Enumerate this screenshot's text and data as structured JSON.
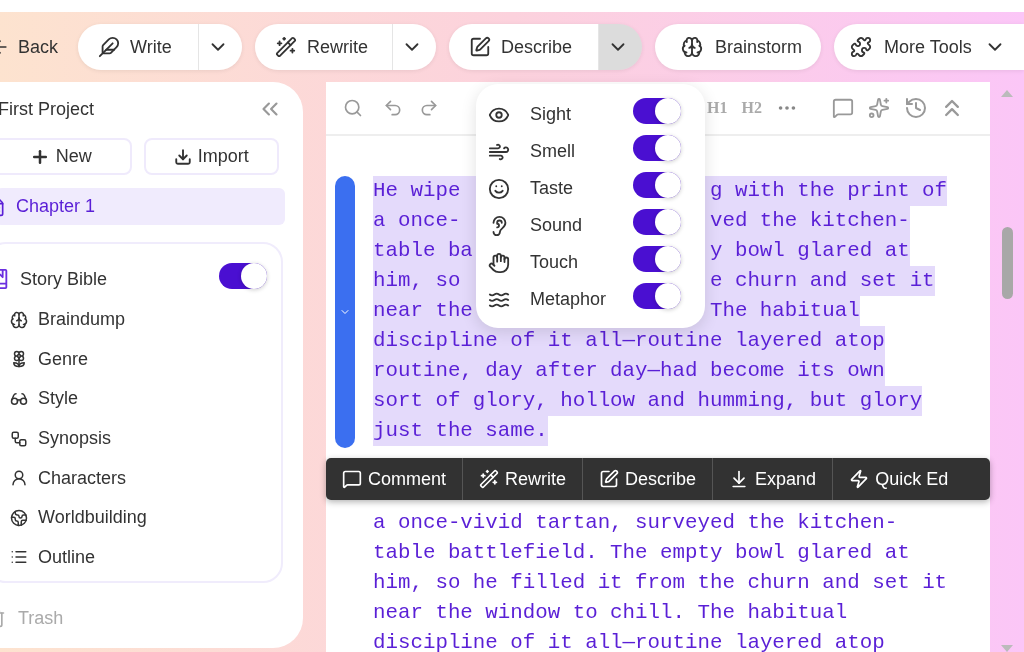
{
  "top_bar": {
    "back": "Back",
    "tools": [
      {
        "label": "Write",
        "kind": "split",
        "open": false
      },
      {
        "label": "Rewrite",
        "kind": "split",
        "open": false
      },
      {
        "label": "Describe",
        "kind": "split",
        "open": true
      },
      {
        "label": "Brainstorm",
        "kind": "plain"
      },
      {
        "label": "More Tools",
        "kind": "menu"
      }
    ]
  },
  "sidebar": {
    "project": "First Project",
    "new": "New",
    "import": "Import",
    "chapters": [
      {
        "label": "Chapter 1",
        "selected": true
      }
    ],
    "story_bible": {
      "label": "Story Bible",
      "on": true,
      "items": [
        "Braindump",
        "Genre",
        "Style",
        "Synopsis",
        "Characters",
        "Worldbuilding",
        "Outline"
      ]
    },
    "trash": "Trash"
  },
  "editor": {
    "toolbar": {
      "headings": [
        "H1",
        "H2"
      ]
    },
    "selected_paragraph": [
      {
        "left": "He wipe",
        "right": "g with the print of"
      },
      {
        "left": "a once-",
        "right": "ved the kitchen-"
      },
      {
        "left": "table ba",
        "right": "y bowl glared at"
      },
      {
        "left": "him, so",
        "right": "e churn and set it"
      },
      {
        "left": "near the",
        "right": "The habitual"
      },
      {
        "left": "discipline of it all—routine layered atop"
      },
      {
        "left": "routine, day after day—had become its own"
      },
      {
        "left": "sort of glory, hollow and humming, but glory"
      },
      {
        "left": "just the same."
      }
    ],
    "next_paragraph": [
      "a once-vivid tartan, surveyed the kitchen-",
      "table battlefield. The empty bowl glared at",
      "him, so he filled it from the churn and set it",
      "near the window to chill. The habitual",
      "discipline of it all—routine layered atop"
    ],
    "selection_toolbar": [
      "Comment",
      "Rewrite",
      "Describe",
      "Expand",
      "Quick Ed"
    ]
  },
  "describe_menu": [
    {
      "label": "Sight",
      "on": true
    },
    {
      "label": "Smell",
      "on": true
    },
    {
      "label": "Taste",
      "on": true
    },
    {
      "label": "Sound",
      "on": true
    },
    {
      "label": "Touch",
      "on": true
    },
    {
      "label": "Metaphor",
      "on": true
    }
  ]
}
